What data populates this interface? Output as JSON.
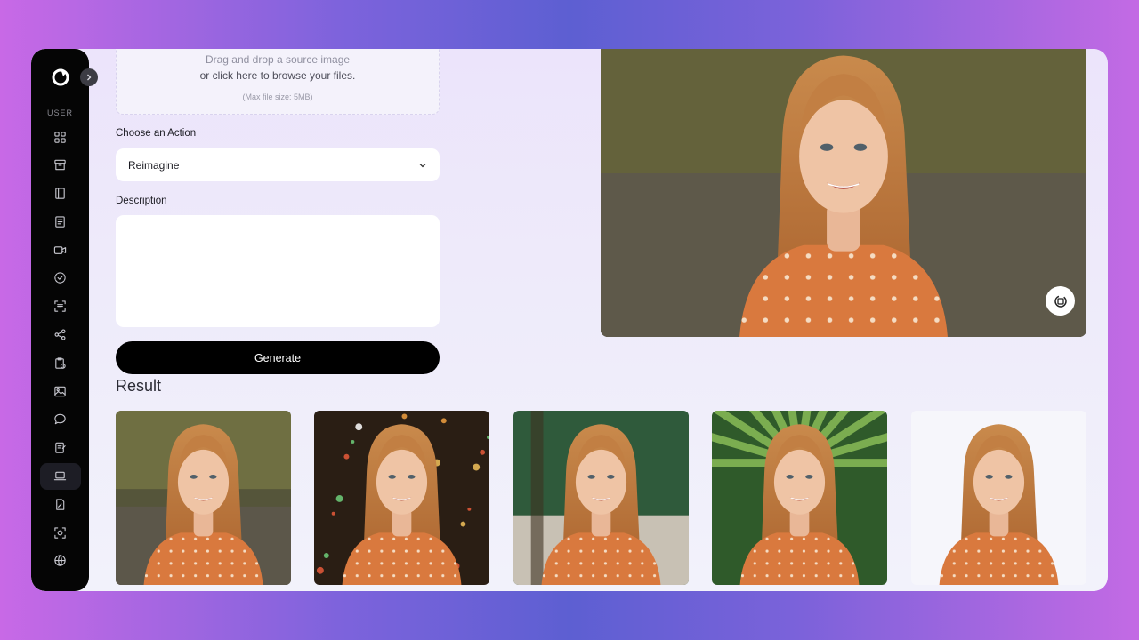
{
  "sidebar": {
    "section_label": "USER",
    "logo": "app-logo",
    "items": [
      {
        "name": "dashboard",
        "icon": "grid-icon"
      },
      {
        "name": "archive",
        "icon": "archive-icon"
      },
      {
        "name": "book",
        "icon": "book-icon"
      },
      {
        "name": "document",
        "icon": "document-icon"
      },
      {
        "name": "video",
        "icon": "video-icon"
      },
      {
        "name": "check",
        "icon": "check-circle-icon"
      },
      {
        "name": "text-scan",
        "icon": "text-scan-icon"
      },
      {
        "name": "share",
        "icon": "share-icon"
      },
      {
        "name": "clipboard",
        "icon": "clipboard-clock-icon"
      },
      {
        "name": "image",
        "icon": "image-icon"
      },
      {
        "name": "chat",
        "icon": "chat-icon"
      },
      {
        "name": "edit-doc",
        "icon": "edit-document-icon"
      },
      {
        "name": "laptop",
        "icon": "laptop-icon",
        "active": true
      },
      {
        "name": "pdf",
        "icon": "file-edit-icon"
      },
      {
        "name": "scan",
        "icon": "scan-icon"
      },
      {
        "name": "web",
        "icon": "globe-www-icon"
      }
    ]
  },
  "upload": {
    "line1": "Drag and drop a source image",
    "line2": "or click here to browse your files.",
    "note": "(Max file size: 5MB)"
  },
  "form": {
    "action_label": "Choose an Action",
    "action_value": "Reimagine",
    "description_label": "Description",
    "description_value": "",
    "generate_label": "Generate"
  },
  "result": {
    "title": "Result",
    "count": 5
  },
  "colors": {
    "sidebar": "#050505",
    "button": "#000000",
    "panel": "#ece4fb"
  }
}
